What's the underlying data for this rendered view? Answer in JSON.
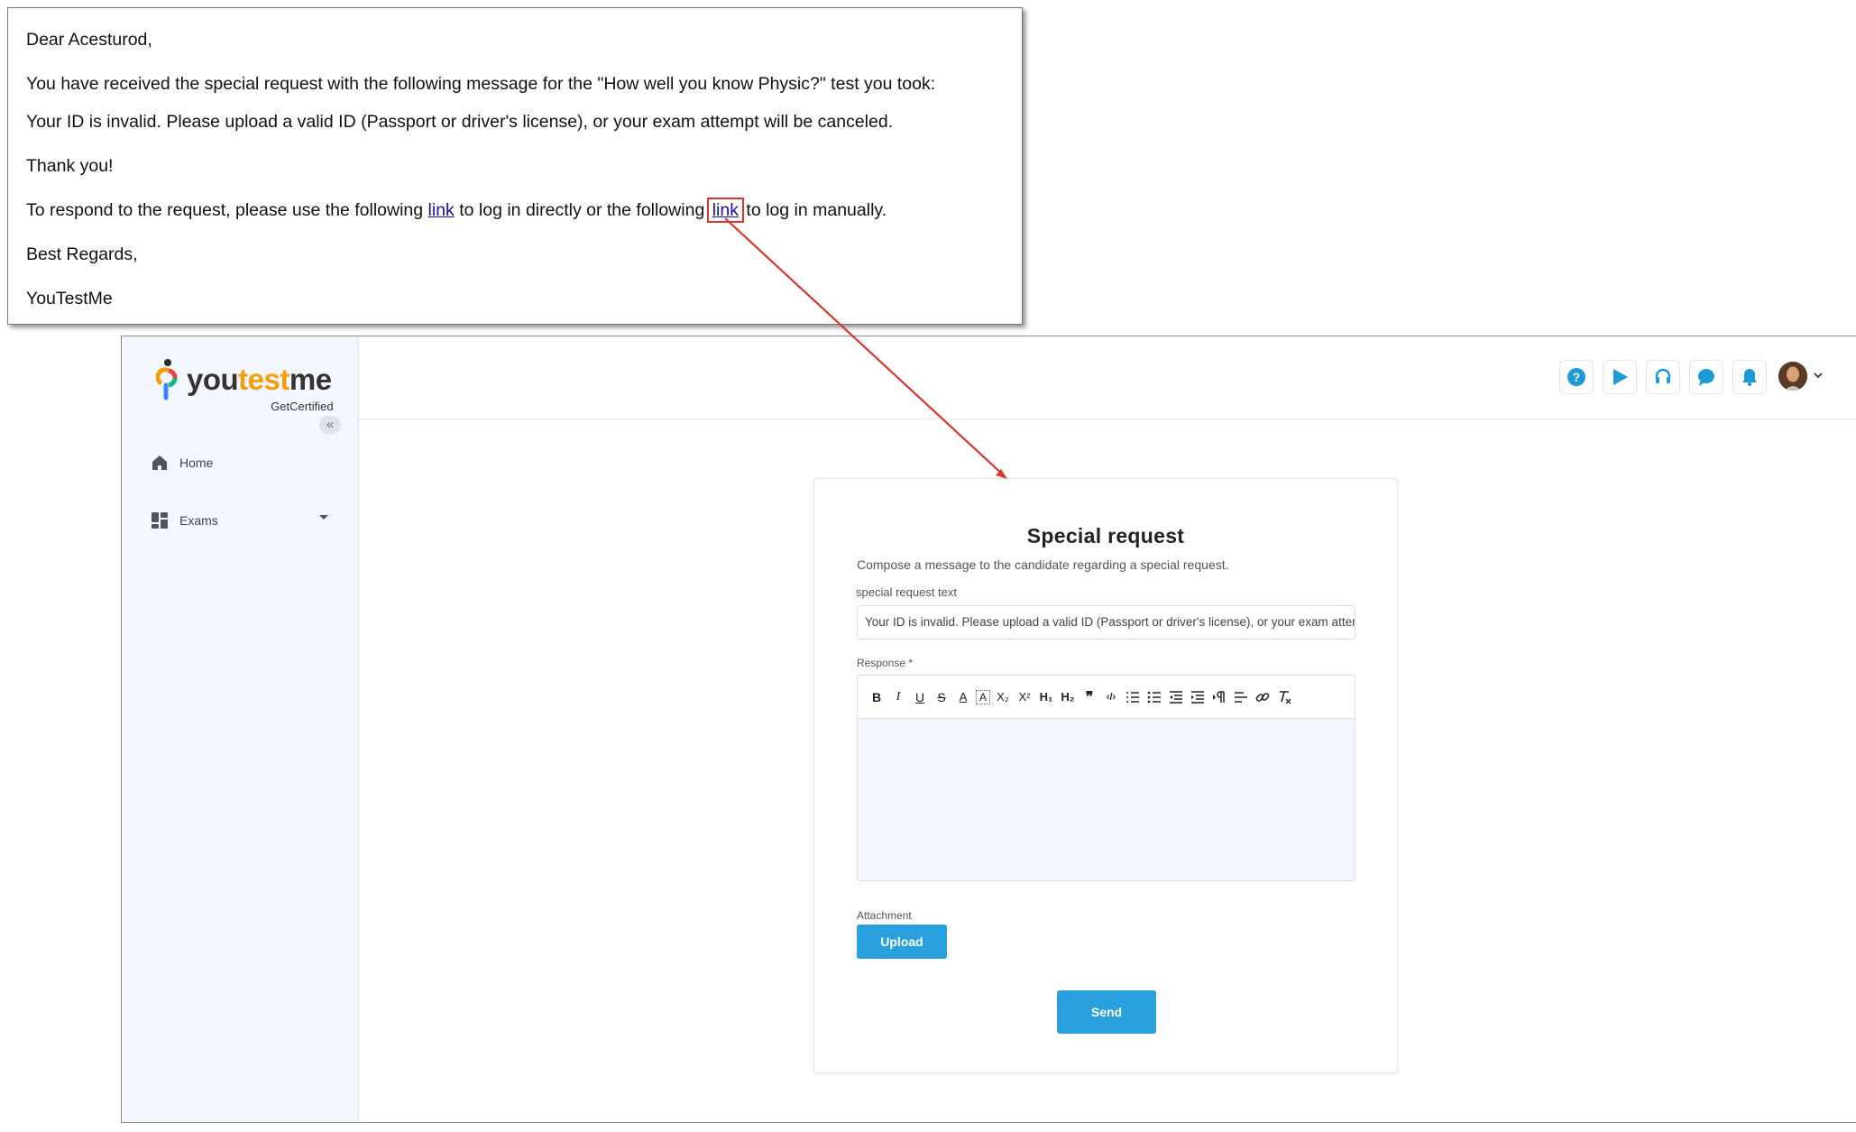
{
  "email": {
    "greeting": "Dear Acesturod,",
    "intro": "You have received the special request with the following message for the \"How well you know Physic?\" test you took:",
    "message": "Your ID is invalid. Please upload a valid ID (Passport or driver's license), or your exam attempt will be canceled.",
    "thanks": "Thank you!",
    "respond_part1": "To respond to the request, please use the following ",
    "link1_label": "link",
    "respond_part2": " to log in directly or the following ",
    "link2_label": "link",
    "respond_part3": " to log in manually.",
    "regards": "Best Regards,",
    "signature": "YouTestMe"
  },
  "app": {
    "logo": {
      "part1": "you",
      "part2": "test",
      "part3": "me",
      "tagline": "GetCertified"
    },
    "sidebar": {
      "items": [
        {
          "label": "Home",
          "icon": "home-icon"
        },
        {
          "label": "Exams",
          "icon": "dashboard-icon"
        }
      ]
    },
    "topbar": {
      "icons": [
        "help-icon",
        "play-icon",
        "headset-icon",
        "chat-icon",
        "bell-icon"
      ]
    },
    "card": {
      "title": "Special request",
      "subtitle": "Compose a message to the candidate regarding a special request.",
      "special_request_label": "special  request text",
      "special_request_value": "Your ID is invalid. Please upload a valid ID (Passport or driver's  license), or your exam attempt will be canceled.",
      "response_label": "Response *",
      "toolbar": [
        "B",
        "I",
        "U",
        "S",
        "A",
        "A",
        "X₂",
        "X²",
        "H₁",
        "H₂",
        "❞",
        "‹/›",
        "ordered-list",
        "bullet-list",
        "outdent",
        "indent",
        "text-direction",
        "align",
        "link",
        "clear-format"
      ],
      "attachment_label": "Attachment",
      "upload_label": "Upload",
      "send_label": "Send"
    }
  },
  "colors": {
    "accent": "#2aa0dc",
    "sidebar_bg": "#f3f6fd",
    "link": "#1a0dab",
    "highlight": "#d9362f"
  }
}
